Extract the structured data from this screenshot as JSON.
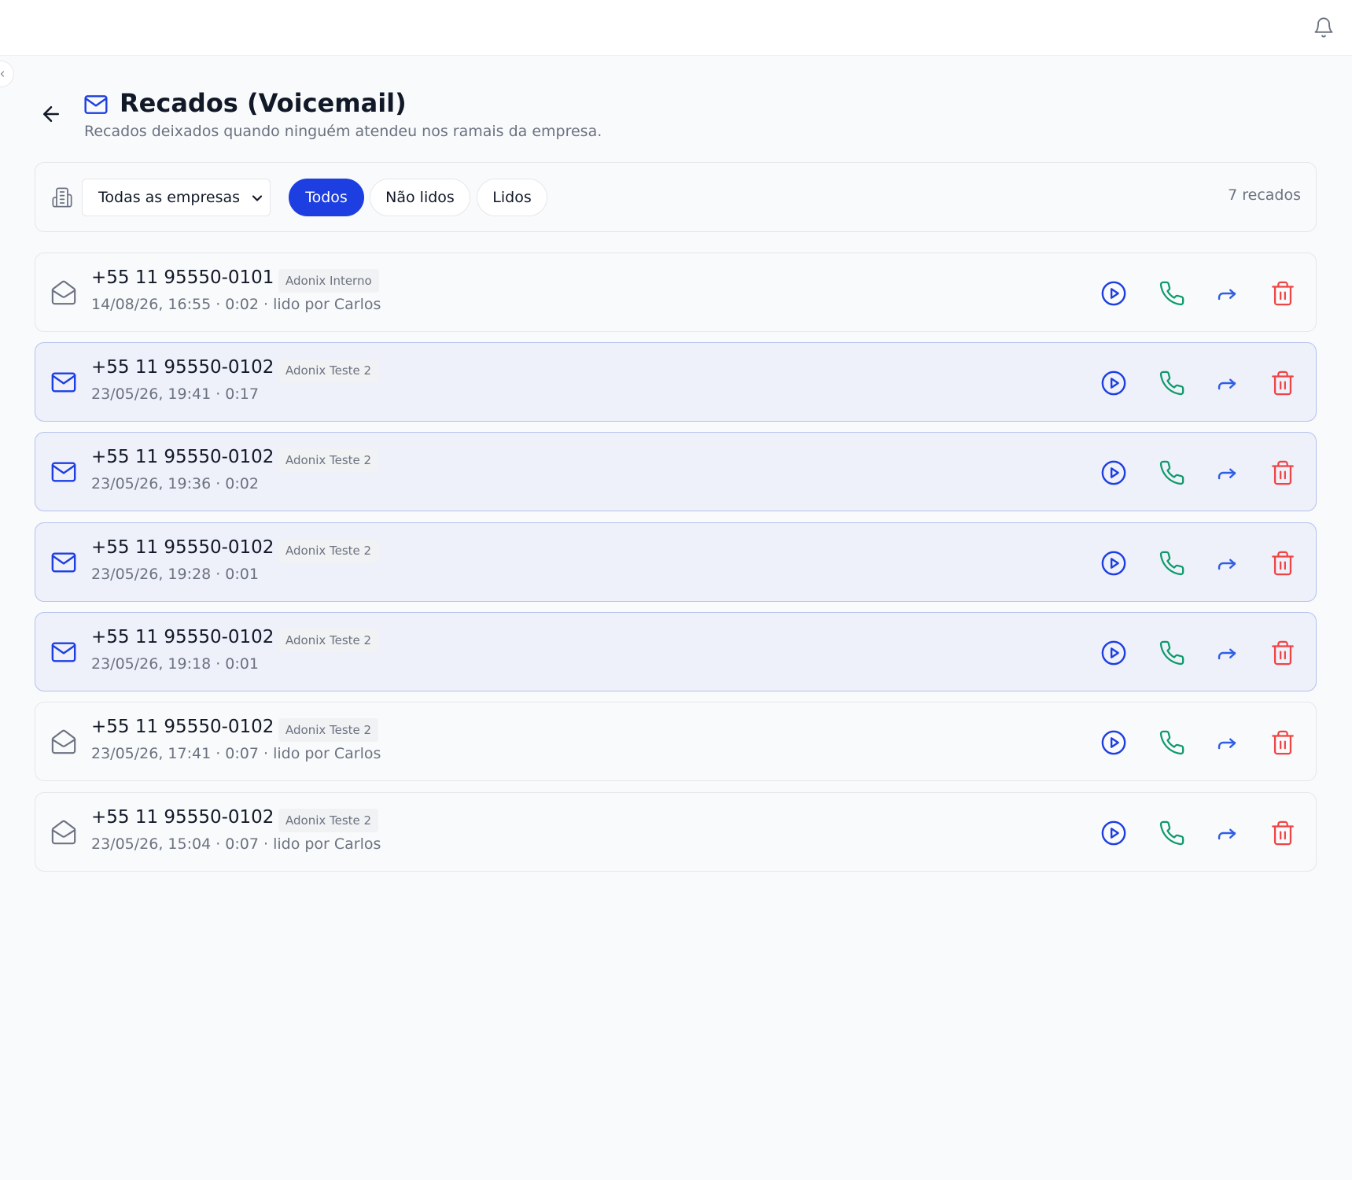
{
  "header": {
    "title": "Recados (Voicemail)",
    "subtitle": "Recados deixados quando ninguém atendeu nos ramais da empresa."
  },
  "filters": {
    "company_select": "Todas as empresas",
    "tabs": [
      {
        "label": "Todos",
        "active": true
      },
      {
        "label": "Não lidos",
        "active": false
      },
      {
        "label": "Lidos",
        "active": false
      }
    ],
    "count": "7 recados"
  },
  "voicemails": [
    {
      "phone": "+55 11 95550-0101",
      "company": "Adonix Interno",
      "meta": "14/08/26, 16:55 · 0:02 · lido por Carlos",
      "read": true
    },
    {
      "phone": "+55 11 95550-0102",
      "company": "Adonix Teste 2",
      "meta": "23/05/26, 19:41 · 0:17",
      "read": false
    },
    {
      "phone": "+55 11 95550-0102",
      "company": "Adonix Teste 2",
      "meta": "23/05/26, 19:36 · 0:02",
      "read": false
    },
    {
      "phone": "+55 11 95550-0102",
      "company": "Adonix Teste 2",
      "meta": "23/05/26, 19:28 · 0:01",
      "read": false
    },
    {
      "phone": "+55 11 95550-0102",
      "company": "Adonix Teste 2",
      "meta": "23/05/26, 19:18 · 0:01",
      "read": false
    },
    {
      "phone": "+55 11 95550-0102",
      "company": "Adonix Teste 2",
      "meta": "23/05/26, 17:41 · 0:07 · lido por Carlos",
      "read": true
    },
    {
      "phone": "+55 11 95550-0102",
      "company": "Adonix Teste 2",
      "meta": "23/05/26, 15:04 · 0:07 · lido por Carlos",
      "read": true
    }
  ],
  "row_actions": [
    "play-icon",
    "phone-icon",
    "forward-icon",
    "trash-icon"
  ],
  "colors": {
    "accent": "#1d3ee0",
    "call": "#0f9a6a",
    "forward": "#2f5ee6",
    "delete": "#ef4444",
    "unread_row": "#eef0fa"
  }
}
